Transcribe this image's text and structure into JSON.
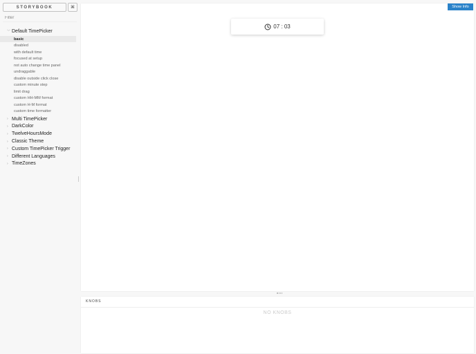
{
  "sidebar": {
    "brand": "STORYBOOK",
    "shortcut": "⌘",
    "filter_placeholder": "Filter",
    "kinds": [
      {
        "label": "Default TimePicker",
        "expanded": true,
        "stories": [
          "basic",
          "disabled",
          "with default time",
          "focused at setup",
          "not auto change time panel",
          "undraggable",
          "disable outside click close",
          "custom minute step",
          "limit drag",
          "custom HH-MM format",
          "custom H-M format",
          "custom time formatter"
        ]
      },
      {
        "label": "Multi TimePicker",
        "expanded": false
      },
      {
        "label": "DarkColor",
        "expanded": false
      },
      {
        "label": "TwelveHoursMode",
        "expanded": false
      },
      {
        "label": "Classic Theme",
        "expanded": false
      },
      {
        "label": "Custom TimePicker Trigger",
        "expanded": false
      },
      {
        "label": "Different Languages",
        "expanded": false
      },
      {
        "label": "TimeZones",
        "expanded": false
      }
    ],
    "active_story": "basic"
  },
  "preview": {
    "show_info_label": "Show Info",
    "time_value": "07 : 03",
    "icon": "clock-icon"
  },
  "addon": {
    "tab_label": "KNOBS",
    "empty_text": "NO KNOBS"
  },
  "colors": {
    "accent": "#2a82c9",
    "active_bg": "#e9e9e9"
  }
}
